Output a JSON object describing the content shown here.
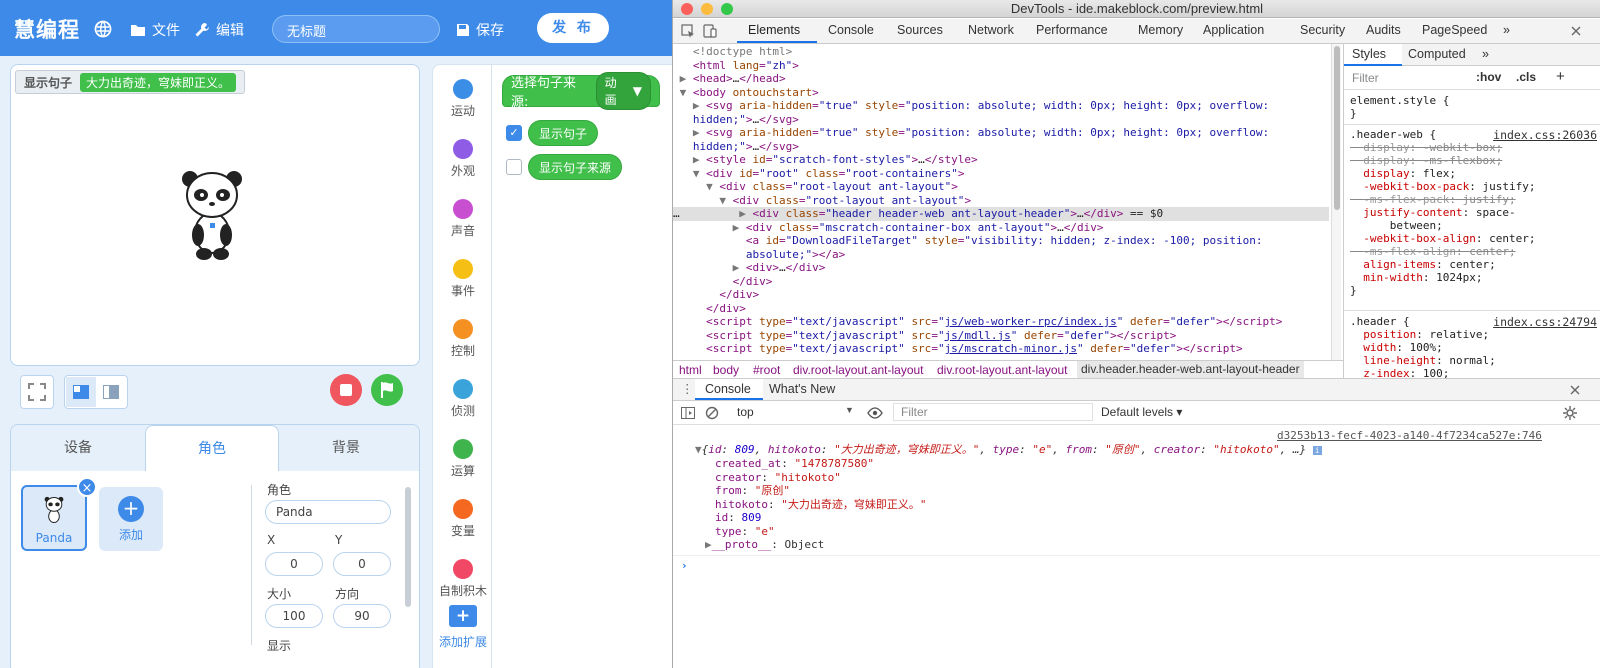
{
  "ide": {
    "logo": "慧编程",
    "menu_file": "文件",
    "menu_edit": "编辑",
    "project_title": "无标题",
    "save_label": "保存",
    "publish_label": "发 布",
    "stage": {
      "monitor_label": "显示句子",
      "monitor_value": "大力出奇迹，穹妹即正义。"
    },
    "tabs": [
      "设备",
      "角色",
      "背景"
    ],
    "active_tab": "角色",
    "sprite_name": "Panda",
    "add_label": "添加",
    "props": {
      "sprite_label": "角色",
      "sprite_value": "Panda",
      "x_label": "X",
      "x_value": "0",
      "y_label": "Y",
      "y_value": "0",
      "size_label": "大小",
      "size_value": "100",
      "direction_label": "方向",
      "direction_value": "90",
      "show_label": "显示"
    },
    "categories": [
      {
        "label": "运动",
        "color": "#3a8ee6"
      },
      {
        "label": "外观",
        "color": "#8f5ce6"
      },
      {
        "label": "声音",
        "color": "#c94fd1"
      },
      {
        "label": "事件",
        "color": "#f5bf14"
      },
      {
        "label": "控制",
        "color": "#f59022"
      },
      {
        "label": "侦测",
        "color": "#3aa3d9"
      },
      {
        "label": "运算",
        "color": "#3fb34c"
      },
      {
        "label": "变量",
        "color": "#f5681f"
      },
      {
        "label": "自制积木",
        "color": "#f04865"
      }
    ],
    "extension_label": "添加扩展",
    "blocks": {
      "hat_text": "选择句子来源:",
      "hat_dropdown": "动画",
      "reporter1": "显示句子",
      "reporter1_checked": true,
      "reporter2": "显示句子来源",
      "reporter2_checked": false
    }
  },
  "devtools": {
    "window_title": "DevTools - ide.makeblock.com/preview.html",
    "tabs": [
      "Elements",
      "Console",
      "Sources",
      "Network",
      "Performance",
      "Memory",
      "Application",
      "Security",
      "Audits",
      "PageSpeed"
    ],
    "active_tab": "Elements",
    "more_tabs": "»",
    "breadcrumbs": [
      "html",
      "body",
      "#root",
      "div.root-layout.ant-layout",
      "div.root-layout.ant-layout",
      "div.header.header-web.ant-layout-header"
    ],
    "styles": {
      "tab_styles": "Styles",
      "tab_computed": "Computed",
      "more": "»",
      "filter_placeholder": "Filter",
      "hov": ":hov",
      "cls": ".cls",
      "plus": "+",
      "element_style": "element.style {",
      "close_brace": "}",
      "rule1_selector": ".header-web {",
      "rule1_source": "index.css:26036",
      "rule2_selector": ".header {",
      "rule2_source": "index.css:24794"
    },
    "drawer_tabs": [
      "Console",
      "What's New"
    ],
    "console": {
      "context": "top",
      "filter_placeholder": "Filter",
      "levels": "Default levels ▾",
      "source_link": "d3253b13-fecf-4023-a140-4f7234ca527e:746",
      "object_fields": [
        {
          "key": "created_at",
          "value": "\"1478787580\"",
          "kind": "str"
        },
        {
          "key": "creator",
          "value": "\"hitokoto\"",
          "kind": "str"
        },
        {
          "key": "from",
          "value": "\"原创\"",
          "kind": "str"
        },
        {
          "key": "hitokoto",
          "value": "\"大力出奇迹，穹妹即正义。\"",
          "kind": "str"
        },
        {
          "key": "id",
          "value": "809",
          "kind": "num"
        },
        {
          "key": "type",
          "value": "\"e\"",
          "kind": "str"
        }
      ],
      "proto_key": "__proto__",
      "proto_value": "Object"
    }
  }
}
